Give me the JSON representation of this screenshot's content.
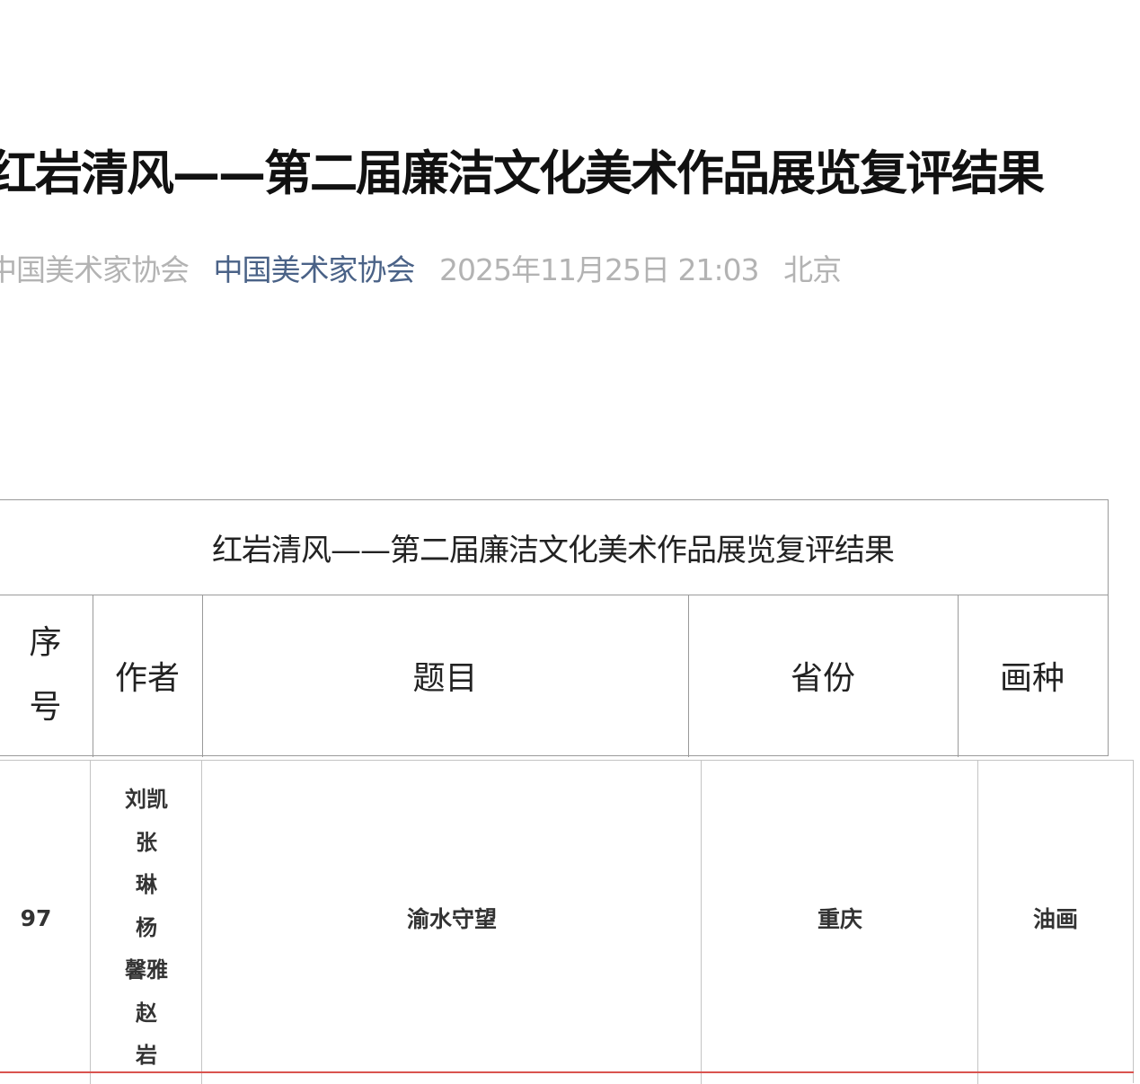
{
  "article": {
    "title": "红岩清风——第二届廉洁文化美术作品展览复评结果",
    "meta": {
      "source": "中国美术家协会",
      "account": "中国美术家协会",
      "datetime": "2025年11月25日 21:03",
      "location": "北京"
    }
  },
  "table": {
    "caption": "红岩清风——第二届廉洁文化美术作品展览复评结果",
    "headers": {
      "seq_line1": "序",
      "seq_line2": "号",
      "author": "作者",
      "title": "题目",
      "province": "省份",
      "category": "画种"
    },
    "rows": [
      {
        "seq": "97",
        "authors": [
          "刘凯",
          "张",
          "琳",
          "杨",
          "馨雅",
          "赵",
          "岩"
        ],
        "title": "渝水守望",
        "province": "重庆",
        "category": "油画"
      }
    ]
  },
  "colors": {
    "title": "#111111",
    "meta_gray": "#b3b3b3",
    "account_link": "#4a6287",
    "border": "#9a9a9a",
    "highlight_line": "#d9534f"
  }
}
